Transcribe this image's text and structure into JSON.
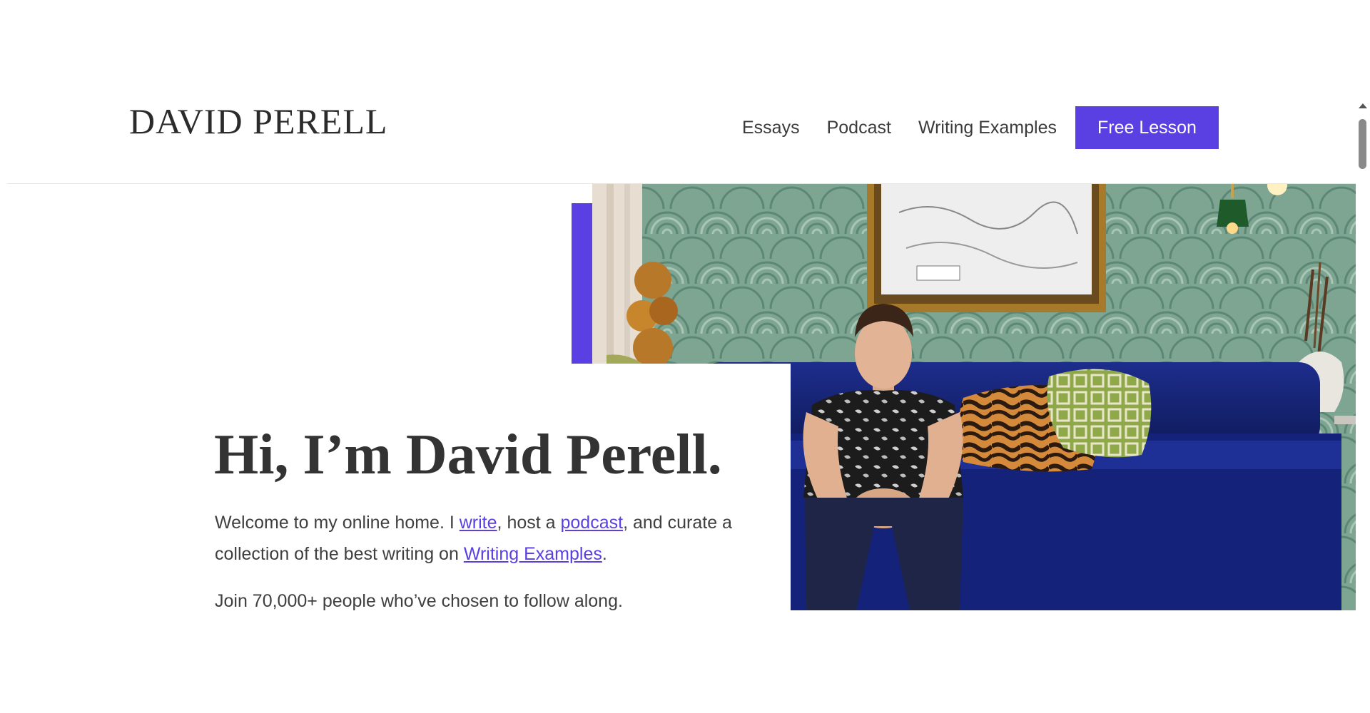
{
  "header": {
    "logo": "DAVID PERELL",
    "nav": {
      "essays": "Essays",
      "podcast": "Podcast",
      "writing_examples": "Writing Examples",
      "cta": "Free Lesson"
    }
  },
  "hero": {
    "headline": "Hi, I’m David Perell.",
    "intro": {
      "part1": "Welcome to my online home. I ",
      "link_write": "write",
      "part2": ", host a ",
      "link_podcast": "podcast",
      "part3": ", and curate a collection of the best writing on ",
      "link_examples": "Writing Examples",
      "part4": "."
    },
    "join": "Join 70,000+ people who’ve chosen to follow along.",
    "photo_icon": "portrait-photo"
  },
  "colors": {
    "accent": "#5a3fe3",
    "text": "#3f3f3f",
    "sofa": "#16237a",
    "wallpaper": "#6f9a86"
  }
}
